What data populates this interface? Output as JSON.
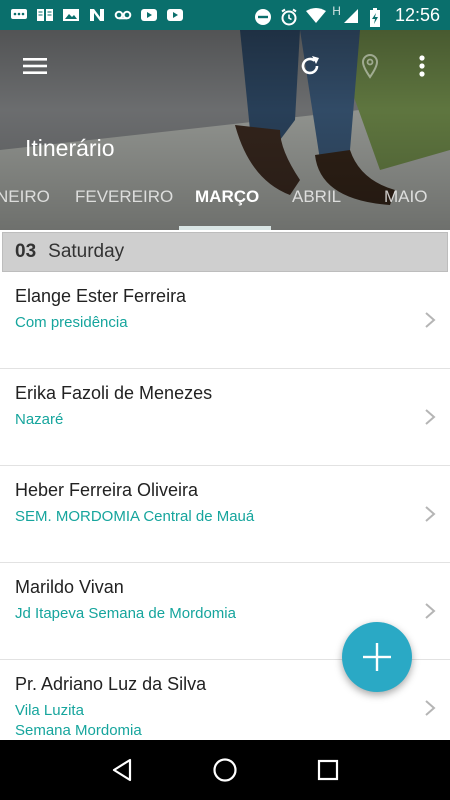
{
  "status_bar": {
    "time": "12:56",
    "network_letter": "H",
    "left_icons": [
      "chat-icon",
      "book-icon",
      "image-icon",
      "n-icon",
      "voicemail-icon",
      "youtube-icon",
      "youtube-icon"
    ],
    "right_icons": [
      "do-not-disturb-icon",
      "alarm-icon",
      "wifi-icon",
      "signal-icon",
      "battery-icon"
    ]
  },
  "header": {
    "title": "Itinerário",
    "tabs": [
      {
        "label": "NEIRO",
        "active": false
      },
      {
        "label": "FEVEREIRO",
        "active": false
      },
      {
        "label": "MARÇO",
        "active": true
      },
      {
        "label": "ABRIL",
        "active": false
      },
      {
        "label": "MAIO",
        "active": false
      }
    ]
  },
  "day": {
    "number": "03",
    "weekday": "Saturday"
  },
  "items": [
    {
      "name": "Elange Ester Ferreira",
      "lines": [
        "Com presidência"
      ]
    },
    {
      "name": "Erika Fazoli de Menezes",
      "lines": [
        "Nazaré"
      ]
    },
    {
      "name": "Heber Ferreira Oliveira",
      "lines": [
        "SEM. MORDOMIA Central de Mauá"
      ]
    },
    {
      "name": "Marildo Vivan",
      "lines": [
        "Jd Itapeva Semana de Mordomia"
      ]
    },
    {
      "name": "Pr. Adriano Luz da Silva",
      "lines": [
        "Vila Luzita",
        "Semana Mordomia"
      ]
    }
  ],
  "colors": {
    "status_bar": "#0a6f6c",
    "accent_text": "#16a59d",
    "fab": "#2aa9c5",
    "day_header_bg": "#cfcfcf"
  }
}
